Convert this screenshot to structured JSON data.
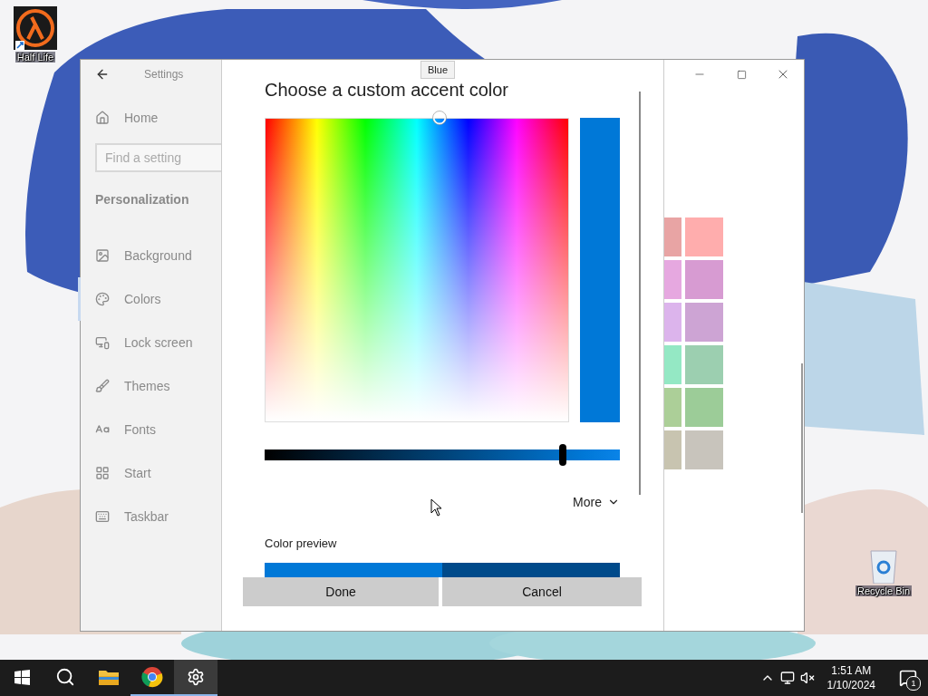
{
  "desktop_icons": [
    {
      "label": "Half Life"
    },
    {
      "label": "Recycle Bin"
    }
  ],
  "window": {
    "title": "Settings"
  },
  "sidebar": {
    "home": "Home",
    "search": {
      "placeholder": "Find a setting"
    },
    "section": "Personalization",
    "items": [
      {
        "label": "Background",
        "selected": false
      },
      {
        "label": "Colors",
        "selected": true
      },
      {
        "label": "Lock screen",
        "selected": false
      },
      {
        "label": "Themes",
        "selected": false
      },
      {
        "label": "Fonts",
        "selected": false
      },
      {
        "label": "Start",
        "selected": false
      },
      {
        "label": "Taskbar",
        "selected": false
      }
    ]
  },
  "dialog": {
    "title": "Choose a custom accent color",
    "tooltip": "Blue",
    "brightness": {
      "level": 0.84
    },
    "more": "More",
    "preview_label": "Color preview",
    "buttons": [
      "Done",
      "Cancel"
    ]
  },
  "swatches": [
    {
      "color": "#e8a4a4"
    },
    {
      "color": "#ffadad"
    },
    {
      "color": "#e6a8e0"
    },
    {
      "color": "#d79bd2"
    },
    {
      "color": "#dcb4ec"
    },
    {
      "color": "#cda4d4"
    },
    {
      "color": "#94e8c4"
    },
    {
      "color": "#9ccfb0"
    },
    {
      "color": "#accf98"
    },
    {
      "color": "#9ccc98"
    },
    {
      "color": "#c8c4b0"
    },
    {
      "color": "#c8c4bc"
    }
  ],
  "taskbar": {
    "time": "1:51 AM",
    "date": "1/10/2024",
    "notifications": "1"
  }
}
